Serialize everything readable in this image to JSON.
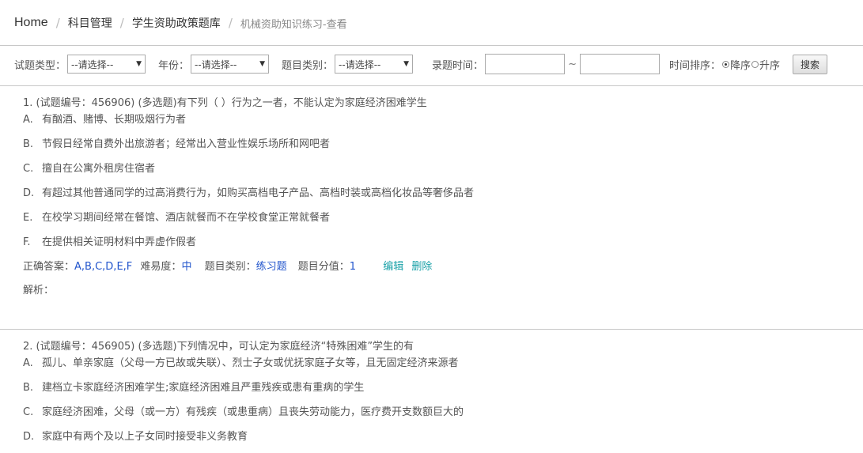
{
  "breadcrumb": {
    "home": "Home",
    "level1": "科目管理",
    "level2": "学生资助政策题库",
    "current": "机械资助知识练习-查看",
    "separator": "/"
  },
  "filters": {
    "type_label": "试题类型：",
    "type_value": "--请选择--",
    "year_label": "年份：",
    "year_value": "--请选择--",
    "category_label": "题目类别：",
    "category_value": "--请选择--",
    "time_label": "录题时间：",
    "time_separator": "~",
    "time_start": "",
    "time_end": "",
    "sort_label": "时间排序：",
    "sort_desc": "降序",
    "sort_asc": "升序",
    "sort_selected": "降序",
    "search_button": "搜索"
  },
  "meta_labels": {
    "answer": "正确答案：",
    "difficulty": "难易度：",
    "category": "题目类别：",
    "score": "题目分值：",
    "edit": "编辑",
    "delete": "删除",
    "analysis": "解析："
  },
  "questions": [
    {
      "title": "1. (试题编号：456906) (多选题)有下列（ ）行为之一者，不能认定为家庭经济困难学生",
      "options": [
        {
          "key": "A.",
          "text": "有酗酒、赌博、长期吸烟行为者"
        },
        {
          "key": "B.",
          "text": "节假日经常自费外出旅游者；经常出入营业性娱乐场所和网吧者"
        },
        {
          "key": "C.",
          "text": "擅自在公寓外租房住宿者"
        },
        {
          "key": "D.",
          "text": "有超过其他普通同学的过高消费行为，如购买高档电子产品、高档时装或高档化妆品等奢侈品者"
        },
        {
          "key": "E.",
          "text": "在校学习期间经常在餐馆、酒店就餐而不在学校食堂正常就餐者"
        },
        {
          "key": "F.",
          "text": "在提供相关证明材料中弄虚作假者"
        }
      ],
      "answer": "A,B,C,D,E,F",
      "difficulty": "中",
      "category": "练习题",
      "score": "1",
      "analysis": ""
    },
    {
      "title": "2. (试题编号：456905) (多选题)下列情况中，可认定为家庭经济“特殊困难”学生的有",
      "options": [
        {
          "key": "A.",
          "text": "孤儿、单亲家庭（父母一方已故或失联）、烈士子女或优抚家庭子女等，且无固定经济来源者"
        },
        {
          "key": "B.",
          "text": "建档立卡家庭经济困难学生;家庭经济困难且严重残疾或患有重病的学生"
        },
        {
          "key": "C.",
          "text": "家庭经济困难，父母（或一方）有残疾（或患重病）且丧失劳动能力，医疗费开支数额巨大的"
        },
        {
          "key": "D.",
          "text": "家庭中有两个及以上子女同时接受非义务教育"
        }
      ]
    }
  ]
}
